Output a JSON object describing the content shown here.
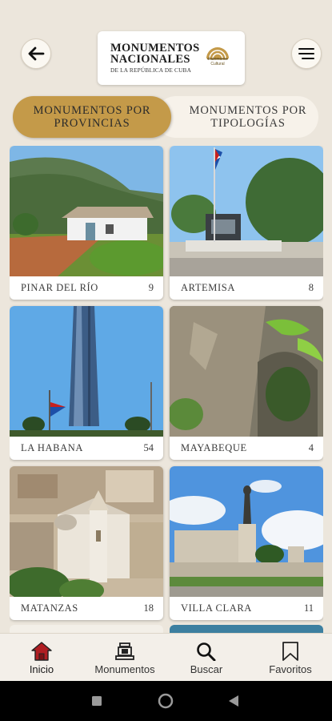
{
  "header": {
    "logo_line1": "MONUMENTOS",
    "logo_line2": "NACIONALES",
    "logo_line3": "DE LA REPÚBLICA DE CUBA",
    "seal_text_1": "Patrimonio",
    "seal_text_2": "Cultural",
    "back_icon": "arrow-left-icon",
    "menu_icon": "menu-icon"
  },
  "tabs": {
    "provincias": "MONUMENTOS POR PROVINCIAS",
    "tipologias": "MONUMENTOS POR TIPOLOGÍAS",
    "active": "provincias"
  },
  "provinces": [
    {
      "name": "PINAR DEL RÍO",
      "count": "9"
    },
    {
      "name": "ARTEMISA",
      "count": "8"
    },
    {
      "name": "LA HABANA",
      "count": "54"
    },
    {
      "name": "MAYABEQUE",
      "count": "4"
    },
    {
      "name": "MATANZAS",
      "count": "18"
    },
    {
      "name": "VILLA CLARA",
      "count": "11"
    }
  ],
  "bottom_nav": {
    "inicio": "Inicio",
    "monumentos": "Monumentos",
    "buscar": "Buscar",
    "favoritos": "Favoritos",
    "active": "inicio"
  },
  "colors": {
    "accent": "#c49a49",
    "background": "#ece6dc",
    "home_icon_active": "#b01e23"
  }
}
